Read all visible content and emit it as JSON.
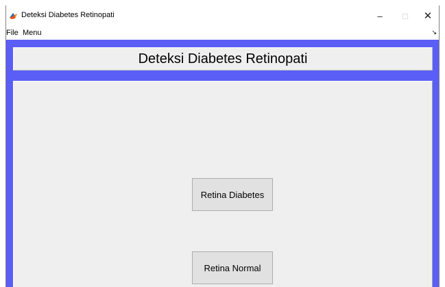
{
  "window": {
    "title": "Deteksi Diabetes Retinopati",
    "icon": "matlab-icon",
    "controls": {
      "minimize": "–",
      "maximize": "□",
      "close": "✕"
    }
  },
  "menubar": {
    "items": [
      {
        "label": "File"
      },
      {
        "label": "Menu"
      }
    ],
    "toolbar_toggle": "↘"
  },
  "figure": {
    "background_color": "#5b5ef6",
    "heading": "Deteksi Diabetes Retinopati",
    "buttons": {
      "diabetes": "Retina Diabetes",
      "normal": "Retina Normal"
    }
  }
}
